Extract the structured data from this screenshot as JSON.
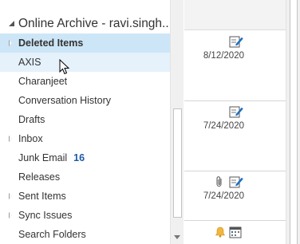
{
  "folder_pane": {
    "account_title": "Online Archive - ravi.singh...",
    "folders": [
      {
        "label": "Deleted Items",
        "expandable": true,
        "state": "selected"
      },
      {
        "label": "AXIS",
        "expandable": false,
        "state": "hover"
      },
      {
        "label": "Charanjeet",
        "expandable": false
      },
      {
        "label": "Conversation History",
        "expandable": false
      },
      {
        "label": "Drafts",
        "expandable": false
      },
      {
        "label": "Inbox",
        "expandable": true
      },
      {
        "label": "Junk Email",
        "expandable": false,
        "count": "16"
      },
      {
        "label": "Releases",
        "expandable": false
      },
      {
        "label": "Sent Items",
        "expandable": true
      },
      {
        "label": "Sync Issues",
        "expandable": true
      },
      {
        "label": "Search Folders",
        "expandable": false
      }
    ]
  },
  "message_list": {
    "items": [
      {
        "date": "8/12/2020",
        "icons": [
          "edit-note-icon"
        ]
      },
      {
        "date": "7/24/2020",
        "icons": [
          "edit-note-icon"
        ]
      },
      {
        "date": "7/24/2020",
        "icons": [
          "paperclip-icon",
          "edit-note-icon"
        ]
      },
      {
        "date": "",
        "icons": [
          "bell-icon",
          "calendar-icon"
        ]
      }
    ]
  },
  "colors": {
    "selected_bg": "#cde6f7",
    "hover_bg": "#e5f1fb",
    "unread_count": "#1d5aa6"
  }
}
